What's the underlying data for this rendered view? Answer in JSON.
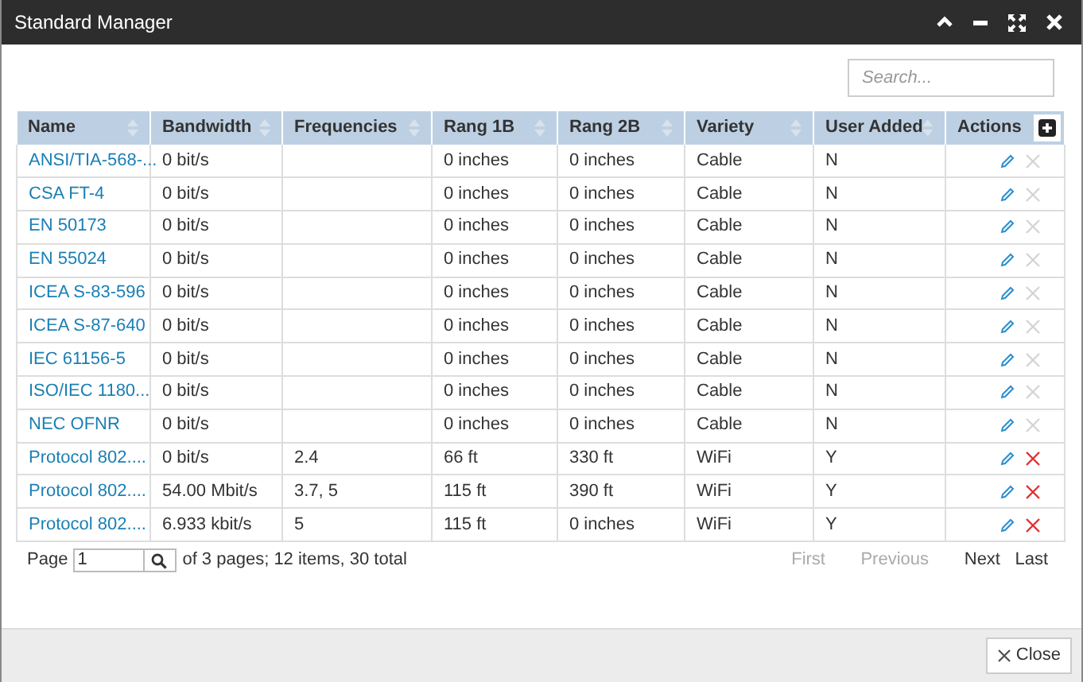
{
  "window": {
    "title": "Standard Manager"
  },
  "search": {
    "placeholder": "Search..."
  },
  "table": {
    "columns": [
      {
        "label": "Name",
        "sortable": true
      },
      {
        "label": "Bandwidth",
        "sortable": true
      },
      {
        "label": "Frequencies",
        "sortable": true
      },
      {
        "label": "Rang 1B",
        "sortable": true
      },
      {
        "label": "Rang 2B",
        "sortable": true
      },
      {
        "label": "Variety",
        "sortable": true
      },
      {
        "label": "User Added",
        "sortable": true
      },
      {
        "label": "Actions",
        "sortable": false
      }
    ],
    "rows": [
      {
        "name": "ANSI/TIA-568-...",
        "bandwidth": "0 bit/s",
        "frequencies": "",
        "rang_1b": "0 inches",
        "rang_2b": "0 inches",
        "variety": "Cable",
        "user_added": "N",
        "deletable": false
      },
      {
        "name": "CSA FT-4",
        "bandwidth": "0 bit/s",
        "frequencies": "",
        "rang_1b": "0 inches",
        "rang_2b": "0 inches",
        "variety": "Cable",
        "user_added": "N",
        "deletable": false
      },
      {
        "name": "EN 50173",
        "bandwidth": "0 bit/s",
        "frequencies": "",
        "rang_1b": "0 inches",
        "rang_2b": "0 inches",
        "variety": "Cable",
        "user_added": "N",
        "deletable": false
      },
      {
        "name": "EN 55024",
        "bandwidth": "0 bit/s",
        "frequencies": "",
        "rang_1b": "0 inches",
        "rang_2b": "0 inches",
        "variety": "Cable",
        "user_added": "N",
        "deletable": false
      },
      {
        "name": "ICEA S-83-596",
        "bandwidth": "0 bit/s",
        "frequencies": "",
        "rang_1b": "0 inches",
        "rang_2b": "0 inches",
        "variety": "Cable",
        "user_added": "N",
        "deletable": false
      },
      {
        "name": "ICEA S-87-640",
        "bandwidth": "0 bit/s",
        "frequencies": "",
        "rang_1b": "0 inches",
        "rang_2b": "0 inches",
        "variety": "Cable",
        "user_added": "N",
        "deletable": false
      },
      {
        "name": "IEC 61156-5",
        "bandwidth": "0 bit/s",
        "frequencies": "",
        "rang_1b": "0 inches",
        "rang_2b": "0 inches",
        "variety": "Cable",
        "user_added": "N",
        "deletable": false
      },
      {
        "name": "ISO/IEC 1180...",
        "bandwidth": "0 bit/s",
        "frequencies": "",
        "rang_1b": "0 inches",
        "rang_2b": "0 inches",
        "variety": "Cable",
        "user_added": "N",
        "deletable": false
      },
      {
        "name": "NEC OFNR",
        "bandwidth": "0 bit/s",
        "frequencies": "",
        "rang_1b": "0 inches",
        "rang_2b": "0 inches",
        "variety": "Cable",
        "user_added": "N",
        "deletable": false
      },
      {
        "name": "Protocol 802....",
        "bandwidth": "0 bit/s",
        "frequencies": "2.4",
        "rang_1b": "66 ft",
        "rang_2b": "330 ft",
        "variety": "WiFi",
        "user_added": "Y",
        "deletable": true
      },
      {
        "name": "Protocol 802....",
        "bandwidth": "54.00 Mbit/s",
        "frequencies": "3.7, 5",
        "rang_1b": "115 ft",
        "rang_2b": "390 ft",
        "variety": "WiFi",
        "user_added": "Y",
        "deletable": true
      },
      {
        "name": "Protocol 802....",
        "bandwidth": "6.933 kbit/s",
        "frequencies": "5",
        "rang_1b": "115 ft",
        "rang_2b": "0 inches",
        "variety": "WiFi",
        "user_added": "Y",
        "deletable": true
      }
    ]
  },
  "pager": {
    "label": "Page",
    "page": "1",
    "summary": "of 3 pages; 12 items, 30 total",
    "links": [
      {
        "label": "First",
        "disabled": true
      },
      {
        "label": "Previous",
        "disabled": true
      },
      {
        "label": "Next",
        "disabled": false
      },
      {
        "label": "Last",
        "disabled": false
      }
    ]
  },
  "footer": {
    "close": "Close"
  }
}
